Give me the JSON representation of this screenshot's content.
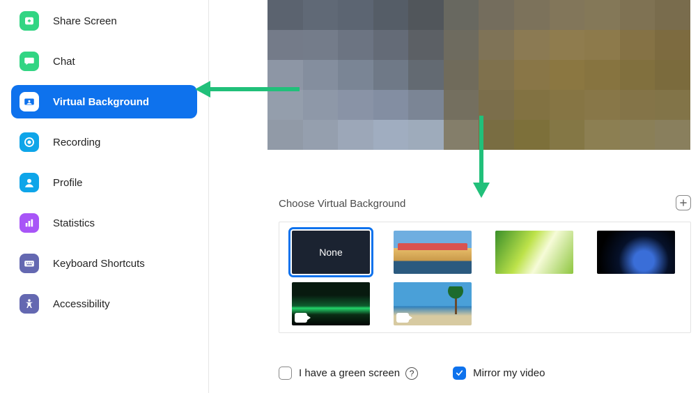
{
  "sidebar": {
    "items": [
      {
        "label": "Share Screen"
      },
      {
        "label": "Chat"
      },
      {
        "label": "Virtual Background"
      },
      {
        "label": "Recording"
      },
      {
        "label": "Profile"
      },
      {
        "label": "Statistics"
      },
      {
        "label": "Keyboard Shortcuts"
      },
      {
        "label": "Accessibility"
      }
    ],
    "active_index": 2
  },
  "main": {
    "section_title": "Choose Virtual Background",
    "thumbs": [
      {
        "name": "none",
        "label": "None",
        "selected": true,
        "has_video_overlay": false
      },
      {
        "name": "bridge",
        "label": "",
        "selected": false,
        "has_video_overlay": false
      },
      {
        "name": "grass",
        "label": "",
        "selected": false,
        "has_video_overlay": false
      },
      {
        "name": "earth",
        "label": "",
        "selected": false,
        "has_video_overlay": false
      },
      {
        "name": "aurora",
        "label": "",
        "selected": false,
        "has_video_overlay": true
      },
      {
        "name": "beach",
        "label": "",
        "selected": false,
        "has_video_overlay": true
      }
    ],
    "checkboxes": {
      "green_screen": {
        "label": "I have a green screen",
        "checked": false
      },
      "mirror": {
        "label": "Mirror my video",
        "checked": true
      }
    }
  },
  "preview_pixels": [
    "5b636f",
    "606976",
    "5c6572",
    "555d67",
    "51565b",
    "686860",
    "746d5d",
    "7c725b",
    "82765a",
    "847858",
    "7f7253",
    "796c4d",
    "747b89",
    "747c8a",
    "6c7482",
    "646b77",
    "5c6065",
    "6e6b5f",
    "7f7357",
    "8b7a53",
    "8f7c4e",
    "8d7a4b",
    "857245",
    "7d6b40",
    "8d96a5",
    "848e9e",
    "7a8595",
    "6f7987",
    "636a72",
    "706b5b",
    "7f714d",
    "897647",
    "8b7741",
    "877440",
    "81703e",
    "7b6b3d",
    "949eac",
    "8e98a8",
    "8993a6",
    "838ea2",
    "7b8595",
    "746f5f",
    "7b6e4b",
    "827242",
    "867544",
    "887748",
    "847448",
    "827448",
    "919aa7",
    "959fae",
    "9ca7b8",
    "a0adc0",
    "9eabbb",
    "847e6a",
    "796d42",
    "7d703a",
    "847745",
    "8c7f52",
    "8a7f57",
    "897f5d"
  ]
}
